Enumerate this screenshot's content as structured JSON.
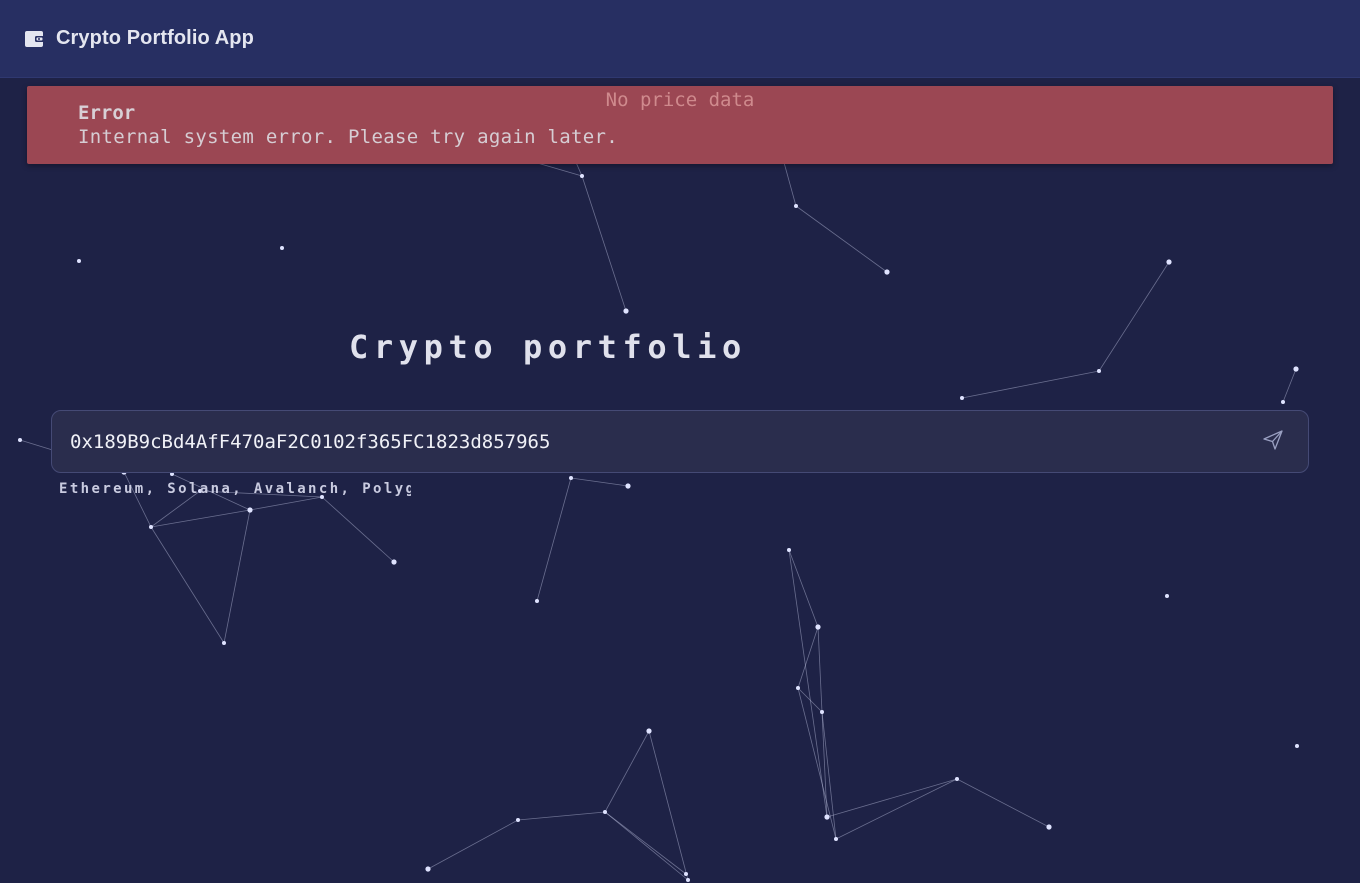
{
  "header": {
    "icon": "wallet-icon",
    "title": "Crypto Portfolio App"
  },
  "error": {
    "title": "Error",
    "message": "Internal system error. Please try again later."
  },
  "status": {
    "no_price": "No price data"
  },
  "main": {
    "heading": "Crypto portfolio",
    "search": {
      "value": "0x189B9cBd4AfF470aF2C0102f365FC1823d857965",
      "send_icon": "send-icon"
    },
    "chains_hint": "Ethereum, Solana, Avalanch, Polygon"
  },
  "colors": {
    "background": "#1e2246",
    "header": "#272f62",
    "error_banner": "#9b4753",
    "particles": "#dfe3ff"
  }
}
